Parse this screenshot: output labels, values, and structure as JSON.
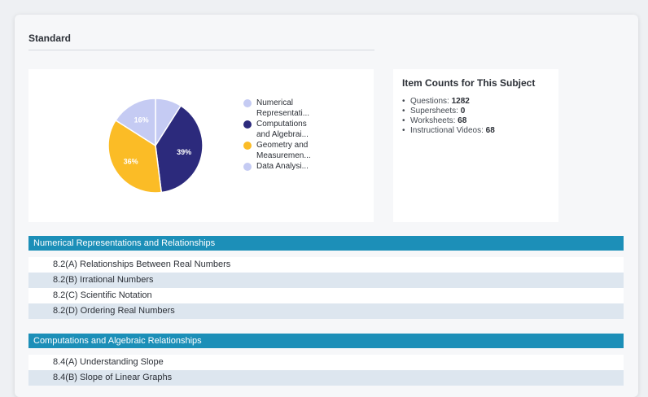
{
  "standard": {
    "title": "Standard"
  },
  "chart_data": {
    "type": "pie",
    "slices": [
      {
        "label": "Numerical Representati...",
        "full_label": [
          "Numerical",
          "Representati..."
        ],
        "value": 9,
        "percent_label": "",
        "color": "#c5cbf3"
      },
      {
        "label": "Computations and Algebrai...",
        "full_label": [
          "Computations",
          "and Algebrai..."
        ],
        "value": 39,
        "percent_label": "39%",
        "color": "#2c2a7c"
      },
      {
        "label": "Geometry and Measuremen...",
        "full_label": [
          "Geometry and",
          "Measuremen..."
        ],
        "value": 36,
        "percent_label": "36%",
        "color": "#fbbc26"
      },
      {
        "label": "Data Analysi...",
        "full_label": [
          "Data Analysi..."
        ],
        "value": 16,
        "percent_label": "16%",
        "color": "#c5cbf3"
      }
    ],
    "legend_position": "right"
  },
  "counts": {
    "title": "Item Counts for This Subject",
    "items": [
      {
        "label": "Questions: ",
        "value": "1282"
      },
      {
        "label": "Supersheets: ",
        "value": "0"
      },
      {
        "label": "Worksheets: ",
        "value": "68"
      },
      {
        "label": "Instructional Videos: ",
        "value": "68"
      }
    ]
  },
  "sections": [
    {
      "title": "Numerical Representations and Relationships",
      "rows": [
        "8.2(A) Relationships Between Real Numbers",
        "8.2(B) Irrational Numbers",
        "8.2(C) Scientific Notation",
        "8.2(D) Ordering Real Numbers"
      ]
    },
    {
      "title": "Computations and Algebraic Relationships",
      "rows": [
        "8.4(A) Understanding Slope",
        "8.4(B) Slope of Linear Graphs"
      ]
    }
  ]
}
